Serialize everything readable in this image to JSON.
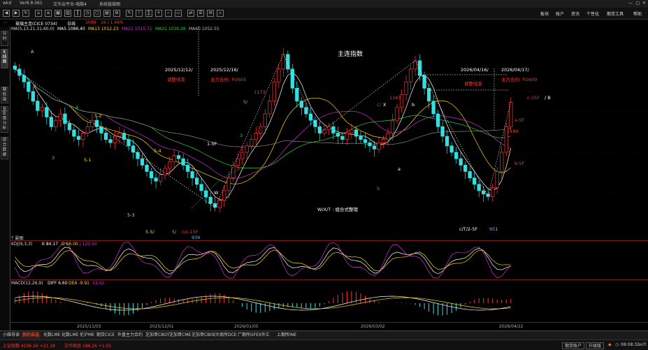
{
  "titlebar": {
    "app_logo": "wkd",
    "version": "Ver8.8.061",
    "menu_items": [
      "文件",
      "云平台",
      "帮助"
    ],
    "window_title": "文华云平台-电脑4",
    "system_link": "系统链接图"
  },
  "menubar": {
    "right_items": [
      "板块",
      "账户",
      "资讯",
      "个性化",
      "期货工具",
      "帮助"
    ]
  },
  "infobar": {
    "instrument": "玻璃主连(CICE 0734)",
    "period": "日线",
    "price": "1098",
    "change": "16 / 1.48%"
  },
  "ma_line": {
    "params": "MA(5,13,21,31,60,0)",
    "items": [
      {
        "text": "MA5 1086.40",
        "color": "#ffffff"
      },
      {
        "text": "MA13 1012.23",
        "color": "#ffd700"
      },
      {
        "text": "MA21 1015.71",
        "color": "#cc33cc"
      },
      {
        "text": "MA31 1039.26",
        "color": "#33cc33"
      },
      {
        "text": "MA60 1052.55",
        "color": "#bbbbbb"
      }
    ]
  },
  "leftbar_tabs": [
    "分时",
    "K线图",
    "期权链",
    "龙虎榜",
    "宏观分析",
    "综合数据"
  ],
  "chart_data": {
    "type": "candlestick",
    "title": "主连指数",
    "x_ticks": [
      "2025/11/03",
      "2025/12/01",
      "2026/01/05",
      "2026/03/02",
      "2026/04/22"
    ],
    "annotations": [
      {
        "text": "2025/12/12/",
        "color": "#ffffff"
      },
      {
        "text": "调整结束",
        "color": "#ff3333"
      },
      {
        "text": "2025/12/16/",
        "color": "#ffffff"
      },
      {
        "text": "主力合约: FG605",
        "color": "#ff3333"
      },
      {
        "text": "2026/04/16/",
        "color": "#ffffff"
      },
      {
        "text": "调整结束",
        "color": "#ff3333"
      },
      {
        "text": "2026/04/17/",
        "color": "#ffffff"
      },
      {
        "text": "主力合约: FG609",
        "color": "#ff3333"
      },
      {
        "text": "W/X/T : 组合式整理",
        "color": "#ffffff"
      },
      {
        "text": "c-15F",
        "color": "#ff3333"
      },
      {
        "text": "/ B",
        "color": "#ffffff"
      },
      {
        "text": "a-5F",
        "color": "#ff3333"
      },
      {
        "text": "b-5F",
        "color": "#cc33cc"
      },
      {
        "text": "1184",
        "color": "#ff3333"
      },
      {
        "text": "c/T/2-5F",
        "color": "#ffffff"
      },
      {
        "text": "951",
        "color": "#33ccff"
      },
      {
        "text": "1163",
        "color": "#ff3333"
      },
      {
        "text": "c/",
        "color": "#cc33cc"
      },
      {
        "text": "X",
        "color": "#ffffff"
      },
      {
        "text": "b",
        "color": "#ffffff"
      },
      {
        "text": "a",
        "color": "#ffffff"
      },
      {
        "text": "b",
        "color": "#cc33cc"
      },
      {
        "text": "1173",
        "color": "#ff3333"
      },
      {
        "text": "5/",
        "color": "#33ccff"
      },
      {
        "text": "3",
        "color": "#33cc33"
      },
      {
        "text": "1-5F",
        "color": "#ffffff"
      },
      {
        "text": "W",
        "color": "#ffffff"
      },
      {
        "text": "5-4",
        "color": "#ffd700"
      },
      {
        "text": "5-5/",
        "color": "#ffd700"
      },
      {
        "text": "5/",
        "color": "#33ccff"
      },
      {
        "text": "c/c-15F",
        "color": "#ff3333"
      },
      {
        "text": "934",
        "color": "#33ccff"
      },
      {
        "text": "5-3",
        "color": "#ffd700"
      },
      {
        "text": "5-2",
        "color": "#ffd700"
      },
      {
        "text": "5-1",
        "color": "#ffd700"
      },
      {
        "text": "4",
        "color": "#33cc33"
      },
      {
        "text": "3",
        "color": "#33ccff"
      },
      {
        "text": "2",
        "color": "#33cc33"
      },
      {
        "text": "1",
        "color": "#33ccff"
      },
      {
        "text": "A",
        "color": "#ffd700"
      }
    ],
    "prices": [
      1150,
      1140,
      1130,
      1115,
      1100,
      1085,
      1090,
      1075,
      1060,
      1070,
      1080,
      1065,
      1055,
      1045,
      1040,
      1050,
      1060,
      1070,
      1060,
      1050,
      1040,
      1035,
      1045,
      1050,
      1040,
      1030,
      1020,
      1010,
      1000,
      990,
      980,
      975,
      985,
      995,
      1005,
      1015,
      1010,
      1000,
      990,
      980,
      970,
      960,
      950,
      940,
      934,
      945,
      960,
      980,
      1000,
      1010,
      1020,
      1030,
      1040,
      1050,
      1060,
      1080,
      1100,
      1130,
      1150,
      1173,
      1150,
      1120,
      1100,
      1090,
      1080,
      1070,
      1060,
      1050,
      1055,
      1060,
      1050,
      1045,
      1040,
      1050,
      1055,
      1045,
      1040,
      1035,
      1030,
      1025,
      1035,
      1040,
      1050,
      1070,
      1090,
      1110,
      1130,
      1150,
      1163,
      1140,
      1120,
      1100,
      1080,
      1060,
      1045,
      1030,
      1020,
      1010,
      1000,
      990,
      980,
      970,
      960,
      955,
      951,
      965,
      990,
      1020,
      1060,
      1098
    ],
    "kdj": {
      "label": "KDJ(9,3,3)",
      "k": "K 84.17",
      "d": "D 66.00",
      "j": "J 120.50"
    },
    "macd": {
      "label": "MACD(12,26,9)",
      "diff": "DIFF 6.60",
      "dea": "DEA -9.91",
      "macd": "33.02"
    }
  },
  "indicator_panel_label": "T 副图",
  "bottom_tabs": [
    "小维导读",
    "我的自选",
    "化数LME",
    "化数LME",
    "伦沪ME",
    "期货CICE",
    "外盘主力合约",
    "芝加哥CBOT",
    "芝加哥CME",
    "芝加哥CBOE",
    "大商所DCE",
    "广期所GFEX",
    "外汇",
    "上期所INE"
  ],
  "active_bottom_tab": 1,
  "status": {
    "index1": "上证指数 4106.26 +21.18",
    "index2": "文华商品 186.16 +1.01",
    "btn_account": "期货账户",
    "btn_upgrade": "升级版",
    "time": "08:08:32",
    "net": "wifi"
  }
}
